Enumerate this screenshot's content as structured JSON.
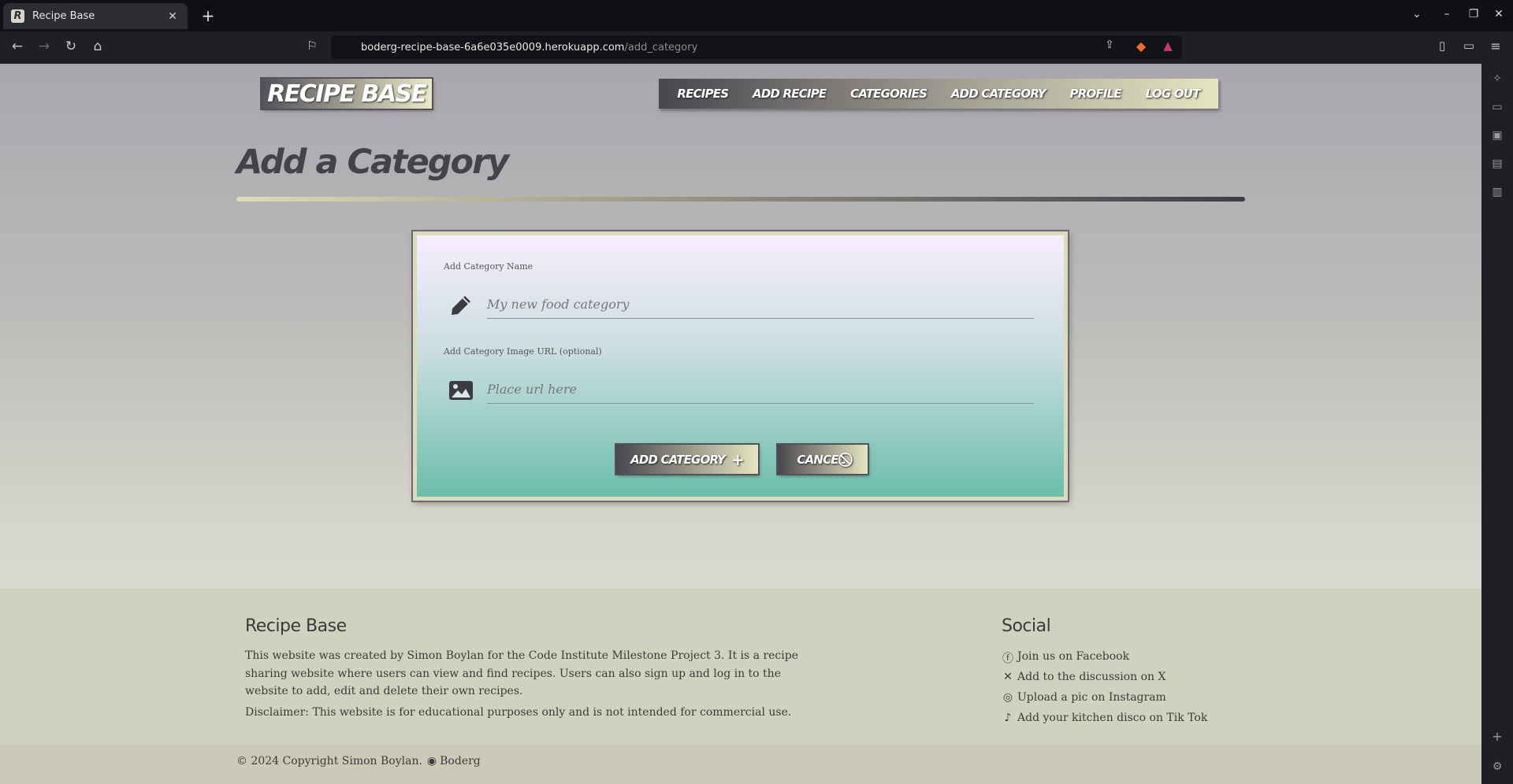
{
  "browser": {
    "tab_title": "Recipe Base",
    "tab_favicon": "R",
    "url_host": "boderg-recipe-base-6a6e035e0009.herokuapp.com",
    "url_path": "/add_category"
  },
  "site": {
    "logo": "RECIPE BASE",
    "nav": [
      "RECIPES",
      "ADD RECIPE",
      "CATEGORIES",
      "ADD CATEGORY",
      "PROFILE",
      "LOG OUT"
    ]
  },
  "main": {
    "heading": "Add a Category",
    "form": {
      "name_label": "Add Category Name",
      "name_placeholder": "My new food category",
      "name_icon": "pencil-icon",
      "image_label": "Add Category Image URL (optional)",
      "image_placeholder": "Place url here",
      "image_icon": "image-icon",
      "submit_label": "ADD CATEGORY",
      "cancel_label": "CANCEL"
    }
  },
  "footer": {
    "title": "Recipe Base",
    "about": "This website was created by Simon Boylan for the Code Institute Milestone Project 3. It is a recipe sharing website where users can view and find recipes. Users can also sign up and log in to the website to add, edit and delete their own recipes.",
    "disclaimer": "Disclaimer: This website is for educational purposes only and is not intended for commercial use.",
    "social_title": "Social",
    "social_links": [
      {
        "icon": "facebook-icon",
        "label": "Join us on Facebook"
      },
      {
        "icon": "x-icon",
        "label": "Add to the discussion on X"
      },
      {
        "icon": "instagram-icon",
        "label": "Upload a pic on Instagram"
      },
      {
        "icon": "tiktok-icon",
        "label": "Add your kitchen disco on Tik Tok"
      }
    ],
    "copyright": "© 2024 Copyright Simon Boylan.",
    "github_label": "Boderg"
  },
  "colors": {
    "page_top": "#a9a6ad",
    "page_bottom": "#e2e2d6",
    "accent_dark": "#49464f",
    "accent_light": "#e6e5c0",
    "card_top": "#f7eeff",
    "card_bottom": "#6bbdaa"
  }
}
